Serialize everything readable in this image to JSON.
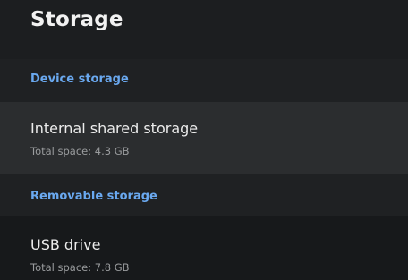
{
  "header": {
    "title": "Storage"
  },
  "sections": [
    {
      "label": "Device storage",
      "items": [
        {
          "title": "Internal shared storage",
          "subtitle": "Total space: 4.3 GB"
        }
      ]
    },
    {
      "label": "Removable storage",
      "items": [
        {
          "title": "USB drive",
          "subtitle": "Total space: 7.8 GB"
        }
      ]
    }
  ],
  "colors": {
    "accent": "#6aa9f0",
    "background": "#17191b",
    "selected_row": "#2b2d2f"
  }
}
